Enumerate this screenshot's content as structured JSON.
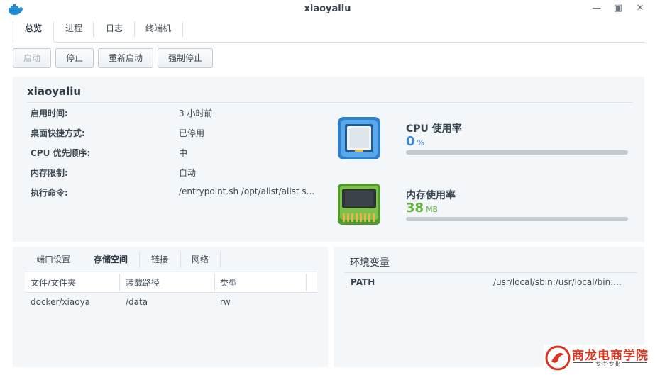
{
  "window": {
    "title": "xiaoyaliu"
  },
  "tabs": [
    "总览",
    "进程",
    "日志",
    "终端机"
  ],
  "actions": {
    "start": "启动",
    "stop": "停止",
    "restart": "重新启动",
    "force_stop": "强制停止"
  },
  "general": {
    "name": "xiaoyaliu",
    "fields": [
      {
        "label": "启用时间:",
        "value": "3 小时前"
      },
      {
        "label": "桌面快捷方式:",
        "value": "已停用"
      },
      {
        "label": "CPU 优先顺序:",
        "value": "中"
      },
      {
        "label": "内存限制:",
        "value": "自动"
      },
      {
        "label": "执行命令:",
        "value": "/entrypoint.sh /opt/alist/alist s..."
      }
    ]
  },
  "resources": {
    "cpu": {
      "label": "CPU 使用率",
      "value": "0",
      "unit": "%",
      "usage_fraction": 0.0,
      "color": "#3b86d8"
    },
    "memory": {
      "label": "内存使用率",
      "value": "38",
      "unit": "MB",
      "usage_fraction": 0.0,
      "color": "#62b33e"
    }
  },
  "storage": {
    "tabs": [
      "端口设置",
      "存储空间",
      "链接",
      "网络"
    ],
    "active_tab": "存储空间",
    "columns": [
      "文件/文件夹",
      "装载路径",
      "类型"
    ],
    "rows": [
      [
        "docker/xiaoya",
        "/data",
        "rw"
      ]
    ]
  },
  "env": {
    "title": "环境变量",
    "rows": [
      {
        "name": "PATH",
        "value": "/usr/local/sbin:/usr/local/bin:..."
      }
    ]
  },
  "watermark": {
    "text": "商龙电商学院",
    "subtitle": "专注·专业"
  },
  "colors": {
    "panel_bg": "#f4f7f9",
    "accent_blue": "#3b86d8",
    "accent_green": "#62b33e",
    "logo_red": "#d9351f"
  }
}
